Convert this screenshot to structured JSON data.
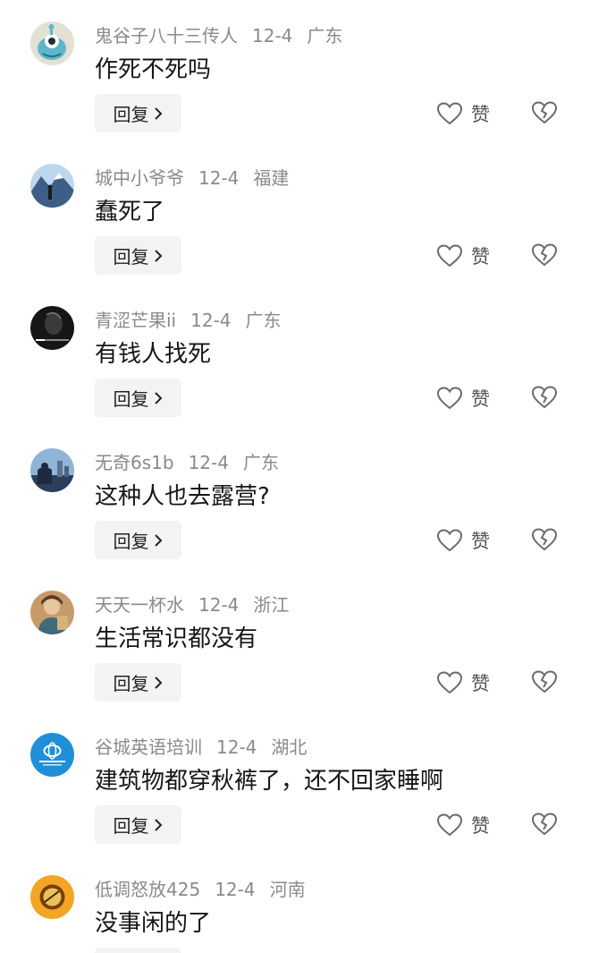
{
  "reply_label": "回复",
  "like_label": "赞",
  "colors": {
    "meta": "#8a8a8a",
    "text": "#161616",
    "reply_bg": "#f3f3f3",
    "icon": "#6a6a6a"
  },
  "comments": [
    {
      "user": "鬼谷子八十三传人",
      "date": "12-4",
      "region": "广东",
      "text": "作死不死吗",
      "avatar": "cartoon-alien-avatar"
    },
    {
      "user": "城中小爷爷",
      "date": "12-4",
      "region": "福建",
      "text": "蠢死了",
      "avatar": "mountain-landscape-avatar"
    },
    {
      "user": "青涩芒果ii",
      "date": "12-4",
      "region": "广东",
      "text": "有钱人找死",
      "avatar": "dark-photo-avatar"
    },
    {
      "user": "无奇6s1b",
      "date": "12-4",
      "region": "广东",
      "text": "这种人也去露营?",
      "avatar": "city-view-avatar"
    },
    {
      "user": "天天一杯水",
      "date": "12-4",
      "region": "浙江",
      "text": "生活常识都没有",
      "avatar": "painting-portrait-avatar"
    },
    {
      "user": "谷城英语培训",
      "date": "12-4",
      "region": "湖北",
      "text": "建筑物都穿秋裤了，还不回家睡啊",
      "avatar": "blue-logo-avatar"
    },
    {
      "user": "低调怒放425",
      "date": "12-4",
      "region": "河南",
      "text": "没事闲的了",
      "avatar": "golden-object-avatar"
    }
  ]
}
